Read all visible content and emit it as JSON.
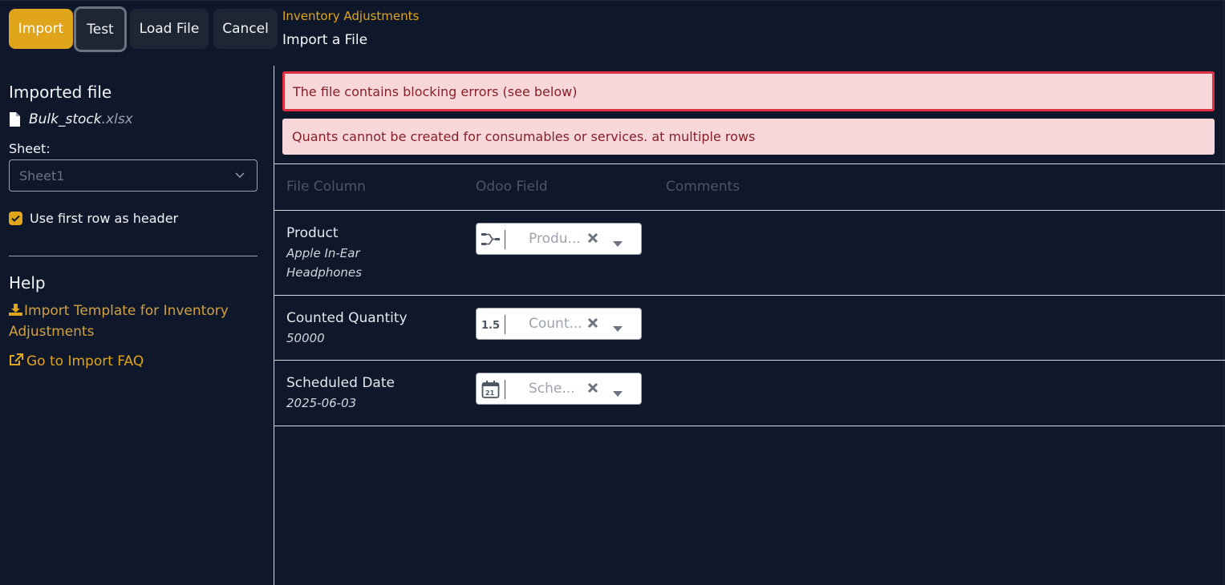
{
  "toolbar": {
    "import_label": "Import",
    "test_label": "Test",
    "load_file_label": "Load File",
    "cancel_label": "Cancel"
  },
  "breadcrumb": {
    "parent": "Inventory Adjustments",
    "current": "Import a File"
  },
  "sidebar": {
    "imported_file_heading": "Imported file",
    "file_name": "Bulk_stock",
    "file_ext": ".xlsx",
    "sheet_label": "Sheet:",
    "sheet_value": "Sheet1",
    "use_header_label": "Use first row as header",
    "use_header_checked": true,
    "help_heading": "Help",
    "template_link": "Import Template for Inventory Adjustments",
    "faq_link": "Go to Import FAQ"
  },
  "alerts": {
    "blocking": "The file contains blocking errors (see below)",
    "detail": "Quants cannot be created for consumables or services. at multiple rows"
  },
  "table": {
    "headers": [
      "File Column",
      "Odoo Field",
      "Comments"
    ],
    "rows": [
      {
        "column": "Product",
        "sample": "Apple In-Ear Headphones",
        "field": "Produ...",
        "icon": "many2one-icon"
      },
      {
        "column": "Counted Quantity",
        "sample": "50000",
        "field": "Count...",
        "icon": "float-icon"
      },
      {
        "column": "Scheduled Date",
        "sample": "2025-06-03",
        "field": "Sche...",
        "icon": "calendar-icon"
      }
    ]
  },
  "colors": {
    "accent": "#e0a51a",
    "background": "#0f172a",
    "alert_bg": "#f8d7da",
    "alert_text": "#842029",
    "alert_border": "#e0303f"
  }
}
